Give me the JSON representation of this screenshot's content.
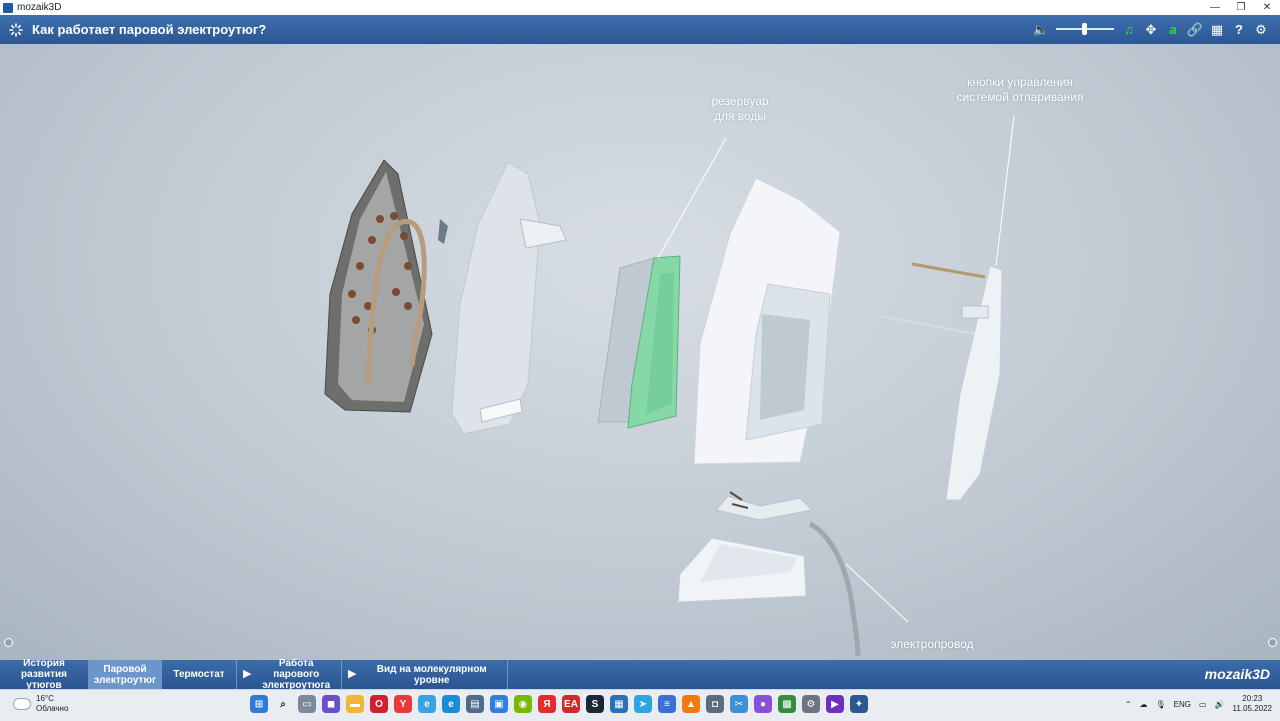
{
  "window": {
    "app_name": "mozaik3D",
    "min": "—",
    "max": "❐",
    "close": "✕"
  },
  "header": {
    "title": "Как работает паровой электроутюг?"
  },
  "toolbar": {
    "icons": [
      "speaker-icon",
      "volume-slider",
      "music-icon",
      "move-icon",
      "text-a-icon",
      "link-icon",
      "grid-icon",
      "help-icon",
      "gear-icon"
    ],
    "speaker": "🔈",
    "music": "♫",
    "move": "✥",
    "text_a": "a",
    "link": "🔗",
    "grid": "▦",
    "help": "?",
    "gear": "⚙"
  },
  "scene": {
    "labels": {
      "reservoir": "резервуар\nдля воды",
      "buttons": "кнопки управления\nсистемой отпаривания",
      "cord": "электропровод"
    }
  },
  "chapters": [
    {
      "label": "История развития утюгов",
      "active": false,
      "play": false
    },
    {
      "label": "Паровой электроутюг",
      "active": true,
      "play": false
    },
    {
      "label": "Термостат",
      "active": false,
      "play": false
    },
    {
      "label": "Работа парового электроутюга",
      "active": false,
      "play": true
    },
    {
      "label": "Вид на молекулярном уровне",
      "active": false,
      "play": true
    }
  ],
  "brand": "mozaik3D",
  "taskbar": {
    "weather_temp": "16°C",
    "weather_desc": "Облачно",
    "lang": "ENG",
    "time": "20:23",
    "date": "11.05.2022"
  },
  "colors": {
    "accent": "#2b5793",
    "active_chapter": "#6c95cc",
    "toolbar_green": "#33dd44"
  }
}
